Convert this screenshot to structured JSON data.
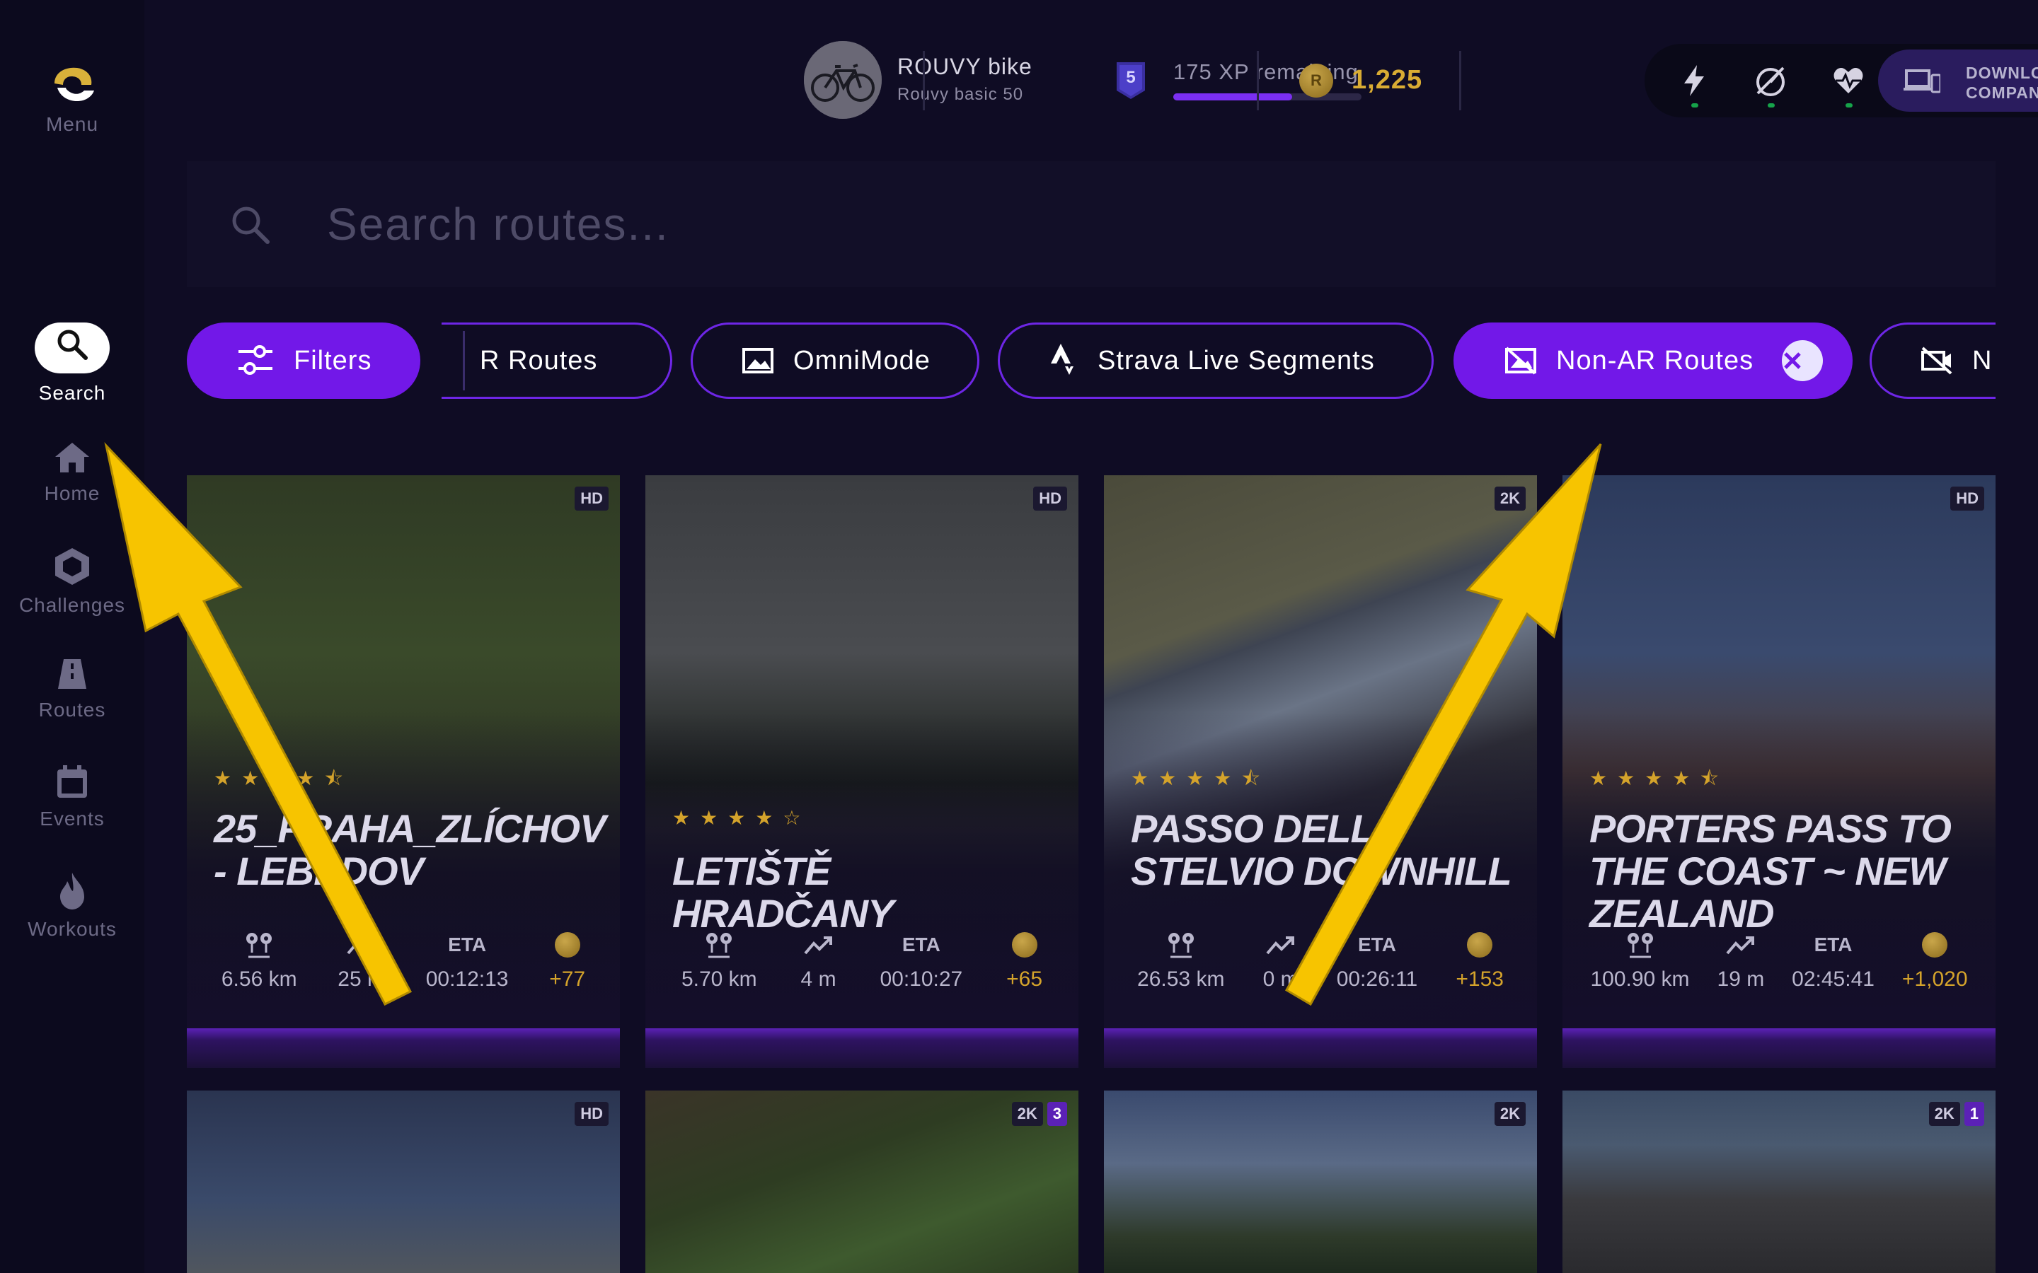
{
  "sidebar": {
    "items": [
      {
        "label": "Menu"
      },
      {
        "label": "Search"
      },
      {
        "label": "Home"
      },
      {
        "label": "Challenges"
      },
      {
        "label": "Routes"
      },
      {
        "label": "Events"
      },
      {
        "label": "Workouts"
      }
    ]
  },
  "header": {
    "bike_name": "ROUVY bike",
    "bike_sub": "Rouvy basic 50",
    "level": "5",
    "xp_label": "175 XP remaining",
    "xp_progress": 0.63,
    "coins": "1,225",
    "companion_line1": "DOWNLOAD",
    "companion_line2": "COMPANION APP"
  },
  "search": {
    "placeholder": "Search routes..."
  },
  "filters": {
    "main": "Filters",
    "chips": [
      "R Routes",
      "OmniMode",
      "Strava Live Segments",
      "Non-AR Routes",
      "N"
    ]
  },
  "cards": [
    {
      "res": "HD",
      "stars": "★★★★⯪",
      "title": "25_PRAHA_ZLÍCHOV - LEBEDOV",
      "distance": "6.56 km",
      "elevation": "25 m",
      "eta_label": "ETA",
      "eta": "00:12:13",
      "coins": "+77"
    },
    {
      "res": "HD",
      "stars": "★★★★☆",
      "title": "LETIŠTĚ HRADČANY",
      "distance": "5.70 km",
      "elevation": "4 m",
      "eta_label": "ETA",
      "eta": "00:10:27",
      "coins": "+65"
    },
    {
      "res": "2K",
      "stars": "★★★★⯪",
      "title": "PASSO DELLO STELVIO DOWNHILL",
      "distance": "26.53 km",
      "elevation": "0 m",
      "eta_label": "ETA",
      "eta": "00:26:11",
      "coins": "+153"
    },
    {
      "res": "HD",
      "stars": "★★★★⯪",
      "title": "PORTERS PASS TO THE COAST ~ NEW ZEALAND",
      "distance": "100.90 km",
      "elevation": "19 m",
      "eta_label": "ETA",
      "eta": "02:45:41",
      "coins": "+1,020"
    },
    {
      "res": "HD"
    },
    {
      "res": "2K",
      "badge": "3"
    },
    {
      "res": "2K"
    },
    {
      "res": "2K",
      "badge": "1"
    }
  ],
  "colors": {
    "accent": "#7218e8",
    "gold": "#d4a32b",
    "arrow": "#f7c400"
  }
}
